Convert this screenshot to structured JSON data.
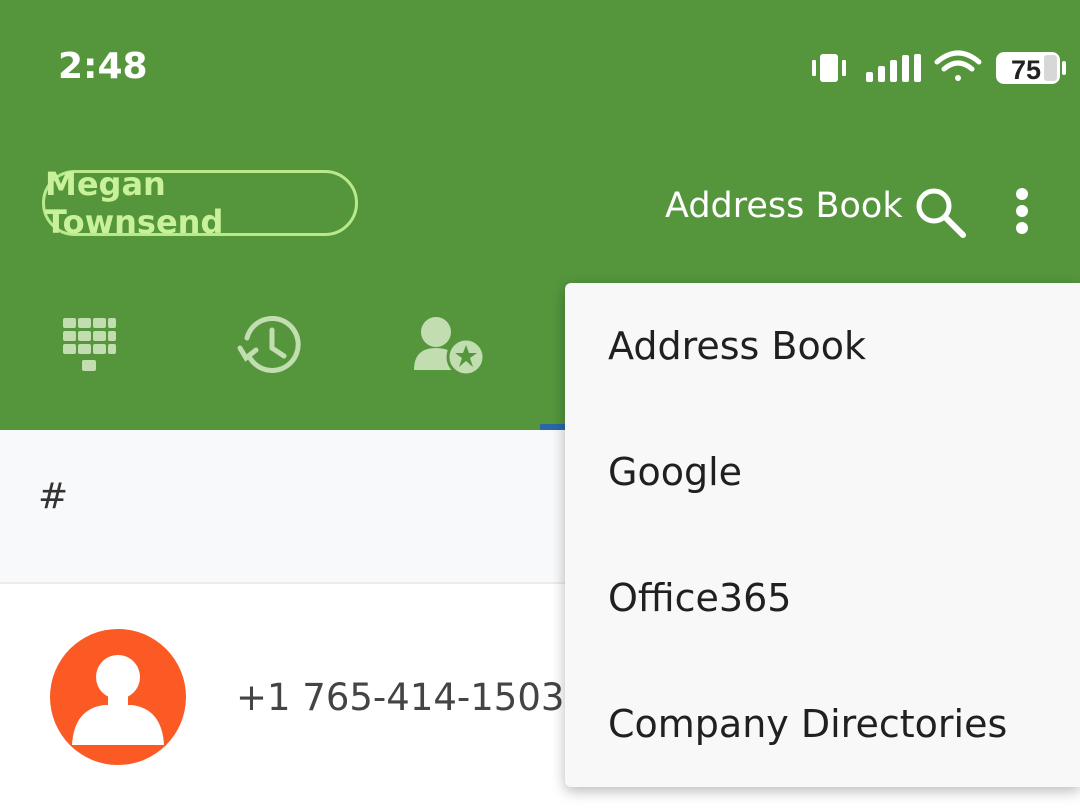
{
  "status_bar": {
    "time": "2:48",
    "battery_level": "75",
    "icons": [
      "vibrate-icon",
      "signal-icon",
      "wifi-icon",
      "battery-icon"
    ]
  },
  "header": {
    "account_name": "Megan Townsend",
    "title": "Address Book",
    "search_icon": "search-icon",
    "more_icon": "more-vert-icon"
  },
  "tabs": [
    {
      "icon": "dialpad-icon"
    },
    {
      "icon": "history-icon"
    },
    {
      "icon": "favorite-contacts-icon"
    }
  ],
  "contacts": {
    "section_letter": "#",
    "items": [
      {
        "number": "+1 765-414-1503",
        "avatar_icon": "person-avatar-icon"
      }
    ]
  },
  "dropdown_menu": {
    "items": [
      {
        "label": "Address Book"
      },
      {
        "label": "Google"
      },
      {
        "label": "Office365"
      },
      {
        "label": "Company Directories"
      }
    ]
  },
  "colors": {
    "app_bar": "#55963d",
    "account_outline": "#b9ea8a",
    "avatar": "#fb5a24",
    "tab_indicator": "#2a67a8"
  }
}
